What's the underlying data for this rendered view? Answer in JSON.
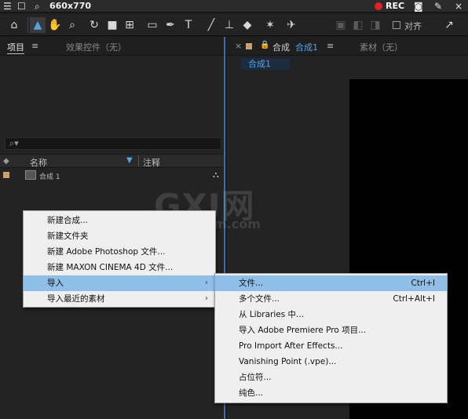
{
  "recorder": {
    "size": "660x770",
    "rec_label": "REC"
  },
  "toolbar": {
    "align_label": "对齐"
  },
  "project_panel": {
    "tab_project": "项目",
    "tab_menu": "≡",
    "tab_effects": "效果控件（无）",
    "search_icon": "⌕▾",
    "columns": {
      "name": "名称",
      "comment": "注释"
    },
    "rows": [
      {
        "name": "合成 1"
      }
    ]
  },
  "composition_panel": {
    "close": "×",
    "tab_prefix": "合成",
    "tab_name": "合成1",
    "tab_menu": "≡",
    "footage_tab": "素材（无）",
    "comp_tab": "合成1"
  },
  "watermark": {
    "big": "GXI网",
    "small": "system.com"
  },
  "context_menu": {
    "items": [
      {
        "label": "新建合成..."
      },
      {
        "label": "新建文件夹"
      },
      {
        "label": "新建 Adobe Photoshop 文件..."
      },
      {
        "label": "新建 MAXON CINEMA 4D 文件..."
      },
      {
        "label": "导入",
        "arrow": "›",
        "highlighted": true
      },
      {
        "label": "导入最近的素材",
        "arrow": "›"
      }
    ]
  },
  "import_submenu": {
    "items": [
      {
        "label": "文件...",
        "shortcut": "Ctrl+I",
        "highlighted": true
      },
      {
        "label": "多个文件...",
        "shortcut": "Ctrl+Alt+I"
      },
      {
        "label": "从 Libraries 中..."
      },
      {
        "label": "导入 Adobe Premiere Pro 项目..."
      },
      {
        "label": "Pro Import After Effects..."
      },
      {
        "label": "Vanishing Point (.vpe)..."
      },
      {
        "label": "占位符..."
      },
      {
        "label": "纯色..."
      }
    ]
  },
  "colors": {
    "accent": "#4fa3e8",
    "menu_highlight": "#8fbfe8",
    "label_swatch": "#c8a26a",
    "rec": "#e0202a"
  }
}
